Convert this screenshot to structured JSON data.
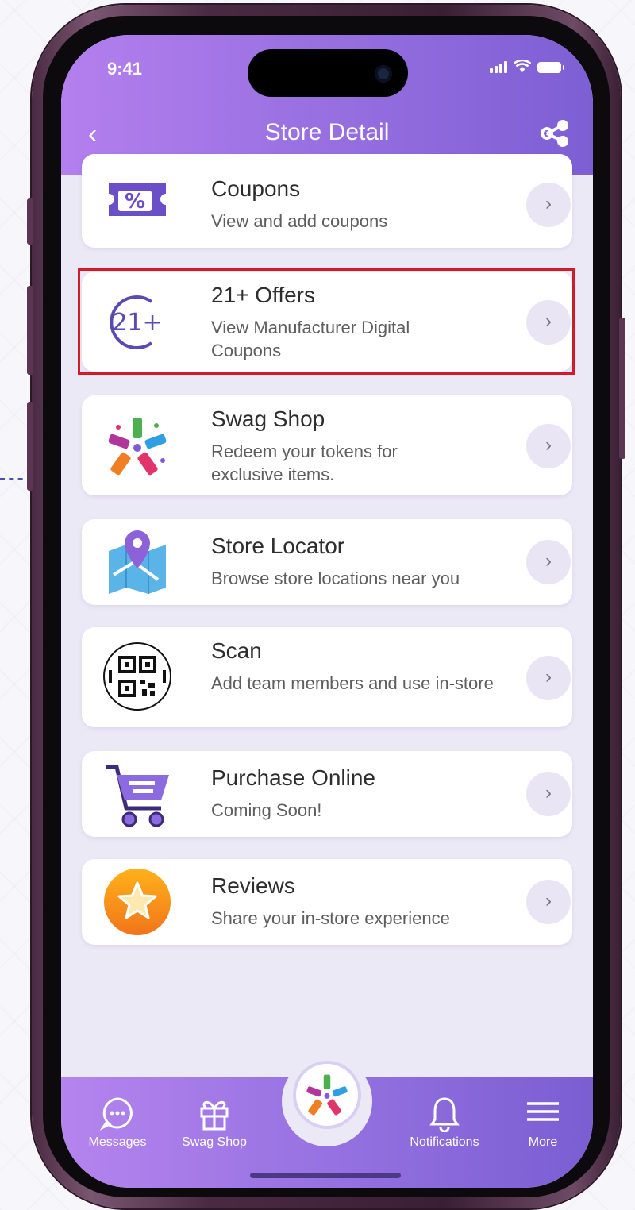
{
  "status_bar": {
    "time": "9:41"
  },
  "header": {
    "back": "‹",
    "title": "Store Detail",
    "share_icon": "share-icon"
  },
  "cards": [
    {
      "id": "coupons",
      "title": "Coupons",
      "desc": "View and add coupons",
      "icon": "coupon-ticket-icon"
    },
    {
      "id": "offers21",
      "title": "21+ Offers",
      "desc": "View Manufacturer Digital Coupons",
      "icon": "age-21-plus-icon",
      "icon_text": "21+"
    },
    {
      "id": "swag",
      "title": "Swag Shop",
      "desc": "Redeem your tokens for exclusive items.",
      "icon": "swag-tags-icon"
    },
    {
      "id": "locator",
      "title": "Store Locator",
      "desc": "Browse store locations near you",
      "icon": "map-pin-icon"
    },
    {
      "id": "scan",
      "title": "Scan",
      "desc": "Add team members and use in-store",
      "icon": "qr-code-icon"
    },
    {
      "id": "purchase",
      "title": "Purchase Online",
      "desc": "Coming Soon!",
      "icon": "shopping-cart-icon"
    },
    {
      "id": "reviews",
      "title": "Reviews",
      "desc": "Share your in-store experience",
      "icon": "star-icon"
    }
  ],
  "chevron": "›",
  "bottom_nav": {
    "messages": "Messages",
    "swag_shop": "Swag Shop",
    "notifications": "Notifications",
    "more": "More"
  },
  "colors": {
    "accent": "#8c6be0",
    "highlight": "#d11a2a",
    "header_start": "#b47fee",
    "header_end": "#7d5fd4"
  }
}
